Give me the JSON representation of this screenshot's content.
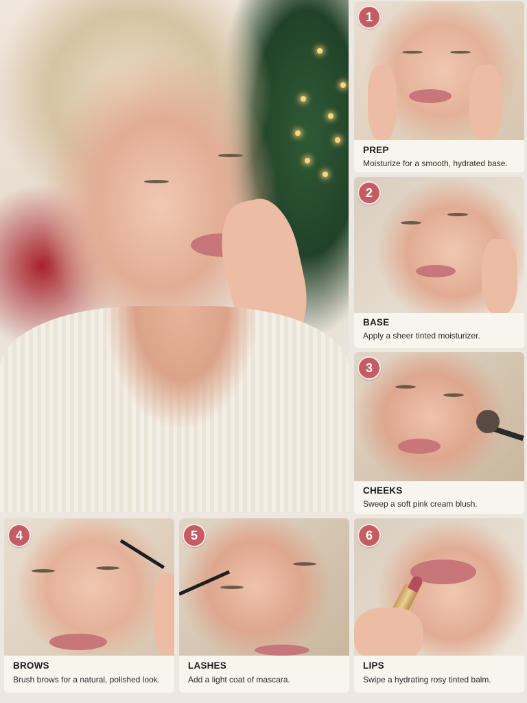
{
  "colors": {
    "badge": "#c45d63",
    "caption_bg": "#f8f4ee",
    "page_bg": "#ece7e1"
  },
  "hero": {
    "description": "Smiling woman with blonde updo in cream knit sweater, Christmas tree background"
  },
  "steps": [
    {
      "number": "1",
      "title": "PREP",
      "text": "Moisturize for a smooth, hydrated base."
    },
    {
      "number": "2",
      "title": "BASE",
      "text": "Apply a sheer tinted moisturizer."
    },
    {
      "number": "3",
      "title": "CHEEKS",
      "text": "Sweep a soft pink cream blush."
    },
    {
      "number": "4",
      "title": "BROWS",
      "text": "Brush brows for a natural, polished look."
    },
    {
      "number": "5",
      "title": "LASHES",
      "text": "Add a light coat of mascara."
    },
    {
      "number": "6",
      "title": "LIPS",
      "text": "Swipe a hydrating rosy tinted balm."
    }
  ]
}
